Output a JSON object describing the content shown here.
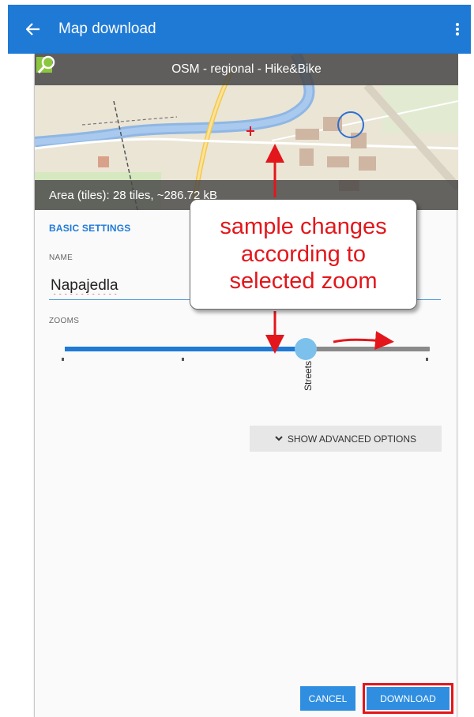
{
  "app_bar": {
    "back_icon": "arrow-left-icon",
    "title": "Map download",
    "menu_icon": "more-vert-icon",
    "color": "#1f7ad6"
  },
  "map_preview": {
    "source_icon": "map-source-icon",
    "source_name": "OSM - regional - Hike&Bike",
    "area_text": "Area (tiles): 28 tiles, ~286.72 kB"
  },
  "settings": {
    "section_title": "BASIC SETTINGS",
    "name_label": "NAME",
    "name_value": "Napajedla",
    "zooms_label": "ZOOMS",
    "zoom_selected_label": "Streets",
    "zoom_level_fraction": 0.66
  },
  "advanced": {
    "icon": "chevron-down-icon",
    "label": "SHOW ADVANCED OPTIONS"
  },
  "actions": {
    "cancel_label": "CANCEL",
    "download_label": "DOWNLOAD"
  },
  "annotation": {
    "line1": "sample changes",
    "line2": "according to",
    "line3": "selected zoom",
    "color": "#e3161b"
  }
}
